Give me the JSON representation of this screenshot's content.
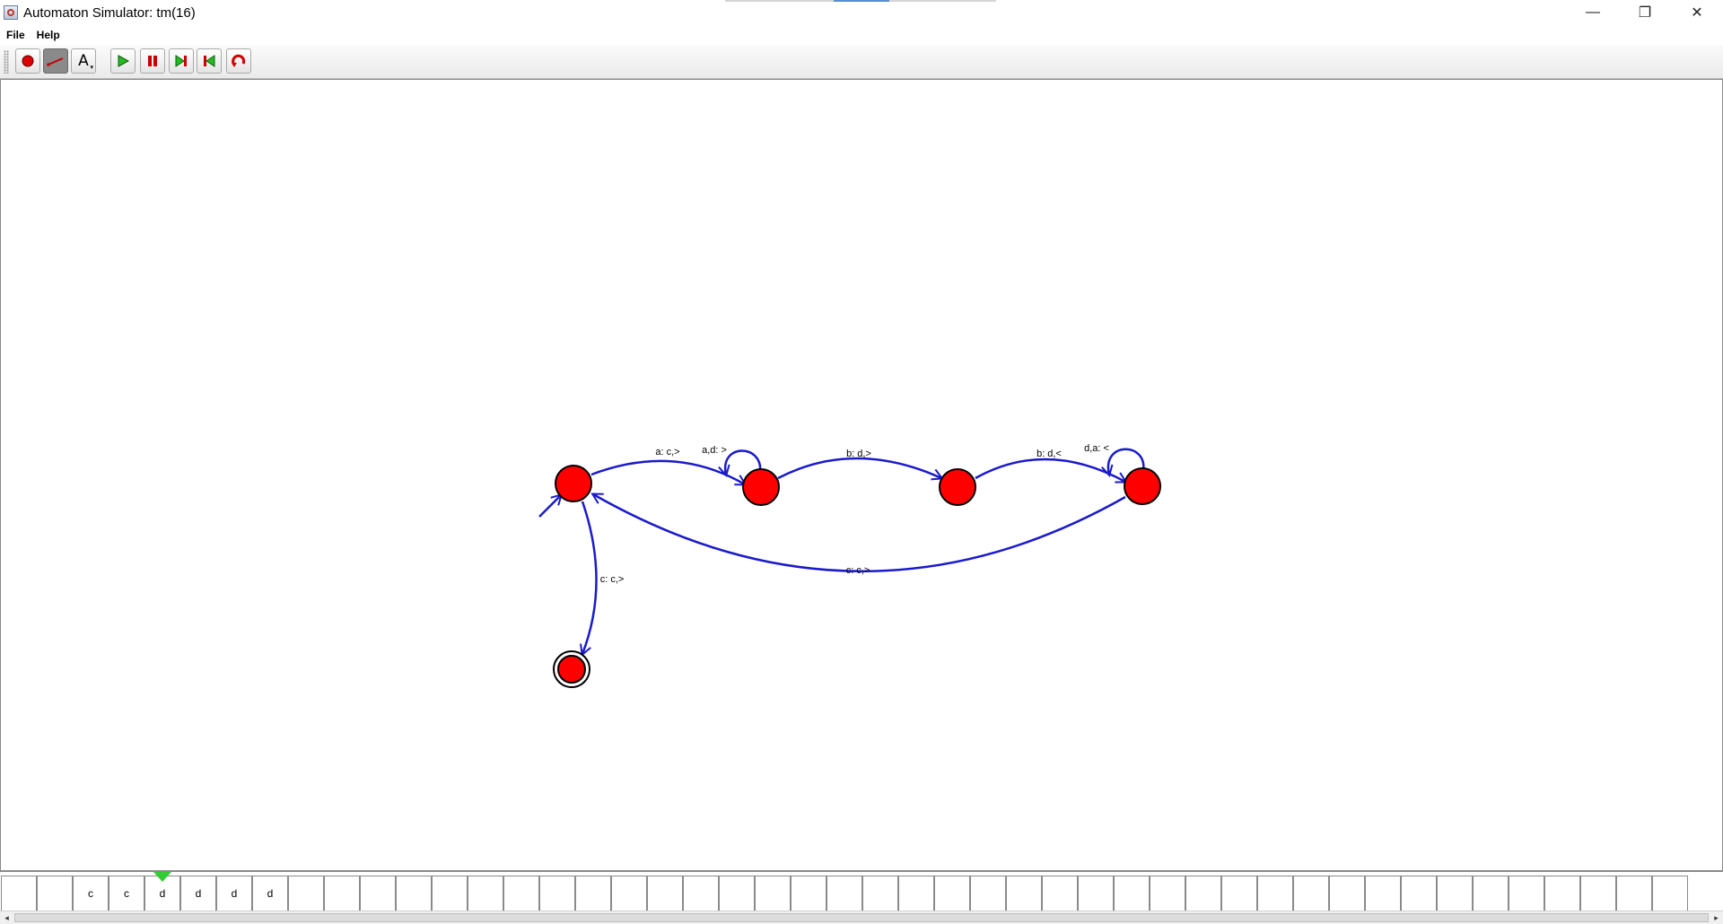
{
  "window": {
    "title": "Automaton Simulator: tm(16)",
    "controls": {
      "minimize": "—",
      "maximize": "❐",
      "close": "✕"
    }
  },
  "menubar": {
    "items": [
      {
        "label": "File"
      },
      {
        "label": "Help"
      }
    ]
  },
  "toolbar": {
    "buttons": [
      {
        "name": "add-state-button",
        "icon": "red-dot-icon"
      },
      {
        "name": "add-transition-button",
        "icon": "arrow-line-icon",
        "selected": true
      },
      {
        "name": "label-tool-button",
        "icon": "text-a-icon",
        "glyph": "A"
      },
      {
        "name": "run-button",
        "icon": "play-icon"
      },
      {
        "name": "pause-button",
        "icon": "pause-icon"
      },
      {
        "name": "step-forward-button",
        "icon": "step-forward-icon"
      },
      {
        "name": "step-back-button",
        "icon": "step-back-icon"
      },
      {
        "name": "reset-button",
        "icon": "reset-icon"
      }
    ]
  },
  "colors": {
    "state_fill": "#ff0000",
    "transition": "#1a1acc",
    "head_marker": "#33cc33"
  },
  "transitions": [
    {
      "id": "t1",
      "label": "a: c,>"
    },
    {
      "id": "t2",
      "label": "a,d: >"
    },
    {
      "id": "t3",
      "label": "b: d,>"
    },
    {
      "id": "t4",
      "label": "b: d,<"
    },
    {
      "id": "t5",
      "label": "d,a: <"
    },
    {
      "id": "t6",
      "label": "c: c,>"
    },
    {
      "id": "t7",
      "label": "c: c,>"
    }
  ],
  "tape": {
    "cells": [
      "",
      "",
      "c",
      "c",
      "d",
      "d",
      "d",
      "d",
      "",
      "",
      "",
      "",
      "",
      "",
      "",
      "",
      "",
      "",
      "",
      "",
      "",
      "",
      "",
      "",
      "",
      "",
      "",
      "",
      "",
      "",
      "",
      "",
      "",
      "",
      "",
      "",
      "",
      "",
      "",
      "",
      "",
      "",
      "",
      "",
      "",
      "",
      "",
      ""
    ],
    "head_index": 4
  }
}
